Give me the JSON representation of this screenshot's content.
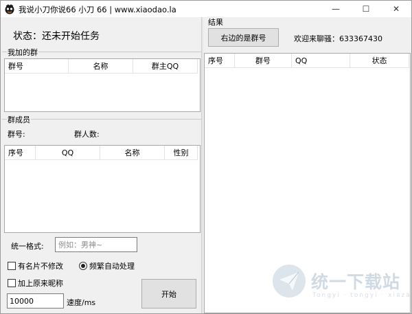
{
  "window": {
    "title": "我说小刀你说66 小刀 66 | www.xiaodao.la",
    "controls": {
      "minimize": "—",
      "maximize": "☐",
      "close": "✕"
    }
  },
  "status": {
    "text": "状态：还未开始任务"
  },
  "my_groups": {
    "title": "我加的群",
    "columns": [
      "群号",
      "名称",
      "群主QQ"
    ]
  },
  "members": {
    "title": "群成员",
    "group_id_label": "群号:",
    "count_label": "群人数:",
    "columns": [
      "序号",
      "QQ",
      "名称",
      "性别"
    ]
  },
  "format": {
    "label": "统一格式:",
    "placeholder": "例如：男神~",
    "value": ""
  },
  "options": {
    "keep_card": "有名片不修改",
    "frequent_auto": "频繁自动处理",
    "append_nickname": "加上原来昵称"
  },
  "speed": {
    "value": "10000",
    "unit": "速度/ms"
  },
  "start_button": "开始",
  "results": {
    "title": "结果",
    "right_is_group_button": "右边的是群号",
    "welcome": "欢迎来聊骚：633367430",
    "columns": [
      "序号",
      "群号",
      "QQ",
      "状态"
    ]
  },
  "watermark": {
    "text": "统一下载站",
    "sub": "Tongyi  ·  tongyi  ·  xiazai"
  },
  "colors": {
    "window_bg": "#f0f0f0",
    "list_bg": "#ffffff",
    "button_bg": "#e1e1e1"
  }
}
